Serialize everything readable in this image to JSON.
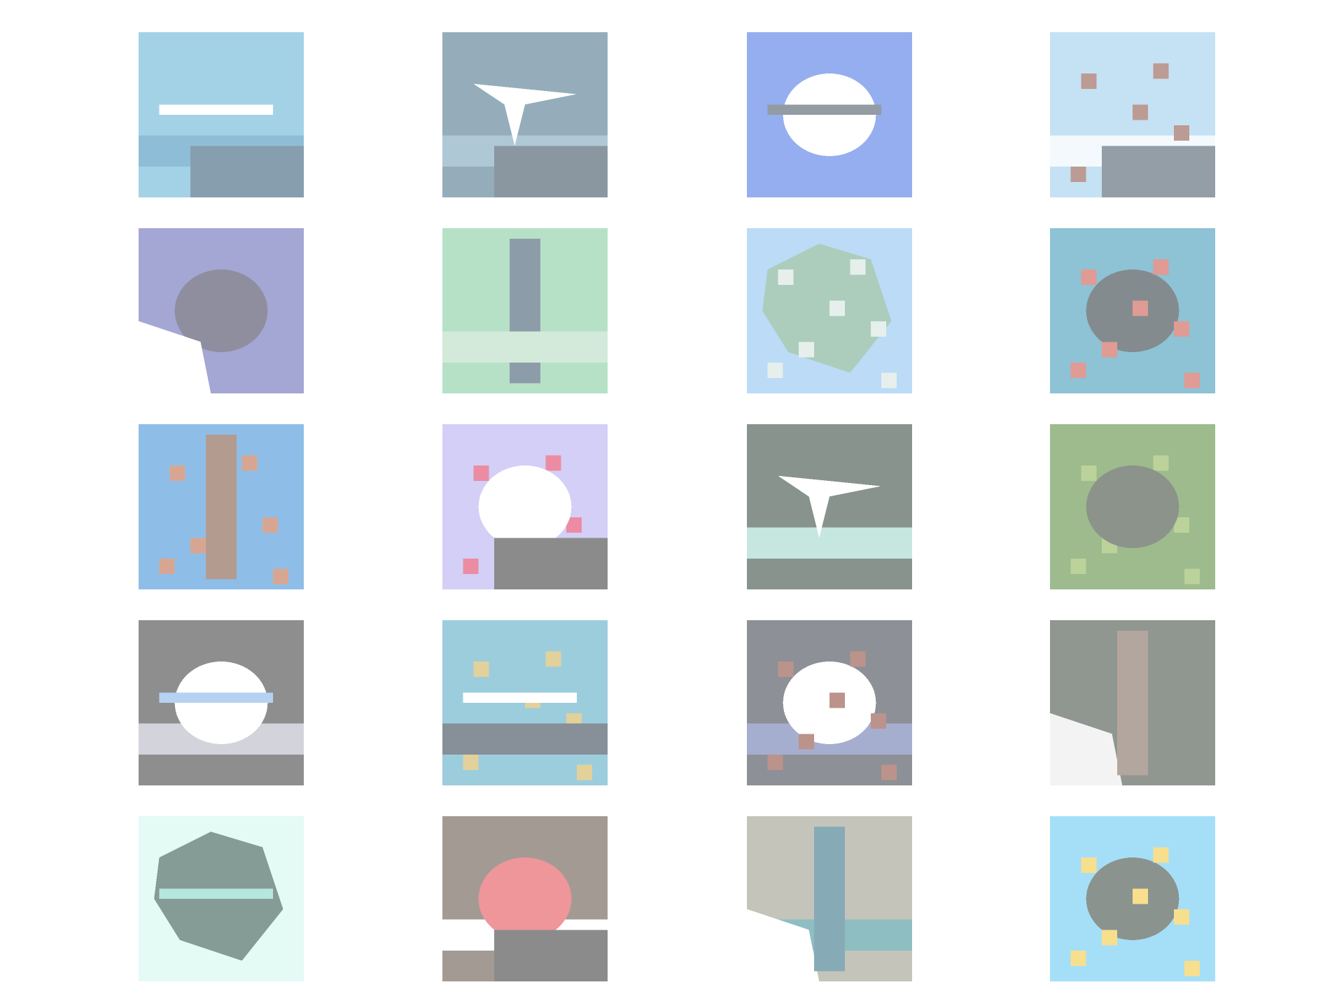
{
  "grid": {
    "rows": 5,
    "cols": 4
  },
  "tiles": [
    {
      "name": "tile-r1c1-water-scene",
      "bg": "#4aa7cf",
      "blobs": [
        {
          "c": "#e8f4fb",
          "shape": "band"
        },
        {
          "c": "#1f7db0",
          "shape": "band"
        },
        {
          "c": "#0f3f5e",
          "shape": "block"
        },
        {
          "c": "#ffffff",
          "shape": "streak"
        }
      ]
    },
    {
      "name": "tile-r1c2-plane-over-sea",
      "bg": "#2e5d78",
      "blobs": [
        {
          "c": "#5f93ad",
          "shape": "band"
        },
        {
          "c": "#ffffff",
          "shape": "plane"
        },
        {
          "c": "#173246",
          "shape": "block"
        }
      ]
    },
    {
      "name": "tile-r1c3-white-vehicle-blue-sky",
      "bg": "#2d5fe0",
      "blobs": [
        {
          "c": "#ffffff",
          "shape": "dome"
        },
        {
          "c": "#2a3a4a",
          "shape": "streak"
        }
      ]
    },
    {
      "name": "tile-r1c4-ship-sky",
      "bg": "#8cc4ea",
      "blobs": [
        {
          "c": "#e9f4fc",
          "shape": "band"
        },
        {
          "c": "#7a3a2a",
          "shape": "splat"
        },
        {
          "c": "#2a3f52",
          "shape": "block"
        }
      ]
    },
    {
      "name": "tile-r2c1-boat-purple",
      "bg": "#4c4fa8",
      "blobs": [
        {
          "c": "#1f1f3f",
          "shape": "dome"
        },
        {
          "c": "#ffffff",
          "shape": "corner"
        }
      ]
    },
    {
      "name": "tile-r2c2-green-trunk",
      "bg": "#6fc491",
      "blobs": [
        {
          "c": "#1d3c55",
          "shape": "trunk"
        },
        {
          "c": "#a8d6b6",
          "shape": "band"
        }
      ]
    },
    {
      "name": "tile-r2c3-rock-light-sky",
      "bg": "#7ab8f0",
      "blobs": [
        {
          "c": "#5c9c7c",
          "shape": "rock"
        },
        {
          "c": "#cfe0d8",
          "shape": "splat"
        }
      ]
    },
    {
      "name": "tile-r2c4-colorful-object-teal",
      "bg": "#1f86ad",
      "blobs": [
        {
          "c": "#0a1a22",
          "shape": "dome"
        },
        {
          "c": "#c0392b",
          "shape": "splat"
        }
      ]
    },
    {
      "name": "tile-r3c1-branches-blue",
      "bg": "#1f7fd0",
      "blobs": [
        {
          "c": "#b0502a",
          "shape": "splat"
        },
        {
          "c": "#6b3a24",
          "shape": "trunk"
        }
      ]
    },
    {
      "name": "tile-r3c2-red-white-lavender",
      "bg": "#a8a0f0",
      "blobs": [
        {
          "c": "#d81b4a",
          "shape": "splat"
        },
        {
          "c": "#ffffff",
          "shape": "dome"
        },
        {
          "c": "#1a1a1a",
          "shape": "block"
        }
      ]
    },
    {
      "name": "tile-r3c3-dark-scene",
      "bg": "#13291f",
      "blobs": [
        {
          "c": "#8fd0c0",
          "shape": "band"
        },
        {
          "c": "#ffffff",
          "shape": "plane"
        }
      ]
    },
    {
      "name": "tile-r3c4-green-foliage",
      "bg": "#3d7a1e",
      "blobs": [
        {
          "c": "#7aa63a",
          "shape": "splat"
        },
        {
          "c": "#1a2a1a",
          "shape": "dome"
        }
      ]
    },
    {
      "name": "tile-r4c1-gray-white-dark",
      "bg": "#202020",
      "blobs": [
        {
          "c": "#a8a8b8",
          "shape": "band"
        },
        {
          "c": "#ffffff",
          "shape": "dome"
        },
        {
          "c": "#6fa6e6",
          "shape": "streak"
        }
      ]
    },
    {
      "name": "tile-r4c2-yellow-on-teal",
      "bg": "#3b9cbc",
      "blobs": [
        {
          "c": "#c7a43a",
          "shape": "splat"
        },
        {
          "c": "#ffffff",
          "shape": "streak"
        },
        {
          "c": "#112233",
          "shape": "band"
        }
      ]
    },
    {
      "name": "tile-r4c3-dark-white-animal",
      "bg": "#1e2430",
      "blobs": [
        {
          "c": "#5060a0",
          "shape": "band"
        },
        {
          "c": "#ffffff",
          "shape": "dome"
        },
        {
          "c": "#7a2a1a",
          "shape": "splat"
        }
      ]
    },
    {
      "name": "tile-r4c4-dark-olive",
      "bg": "#243024",
      "blobs": [
        {
          "c": "#e8e8e8",
          "shape": "corner"
        },
        {
          "c": "#6a5040",
          "shape": "trunk"
        }
      ]
    },
    {
      "name": "tile-r5c1-mint-shape",
      "bg": "#c8f6ec",
      "blobs": [
        {
          "c": "#0e3a30",
          "shape": "rock"
        },
        {
          "c": "#6fd0c0",
          "shape": "streak"
        }
      ]
    },
    {
      "name": "tile-r5c2-red-machine",
      "bg": "#4a3a2a",
      "blobs": [
        {
          "c": "#ffffff",
          "shape": "band"
        },
        {
          "c": "#e0303a",
          "shape": "dome"
        },
        {
          "c": "#1a1a1a",
          "shape": "block"
        }
      ]
    },
    {
      "name": "tile-r5c3-teal-and-gray",
      "bg": "#8a8a7a",
      "blobs": [
        {
          "c": "#1f7f86",
          "shape": "band"
        },
        {
          "c": "#ffffff",
          "shape": "corner"
        },
        {
          "c": "#0f5a70",
          "shape": "trunk"
        }
      ]
    },
    {
      "name": "tile-r5c4-creature-blue-sky",
      "bg": "#4ec0f0",
      "blobs": [
        {
          "c": "#1a2a20",
          "shape": "dome"
        },
        {
          "c": "#f0c020",
          "shape": "splat"
        }
      ]
    }
  ]
}
